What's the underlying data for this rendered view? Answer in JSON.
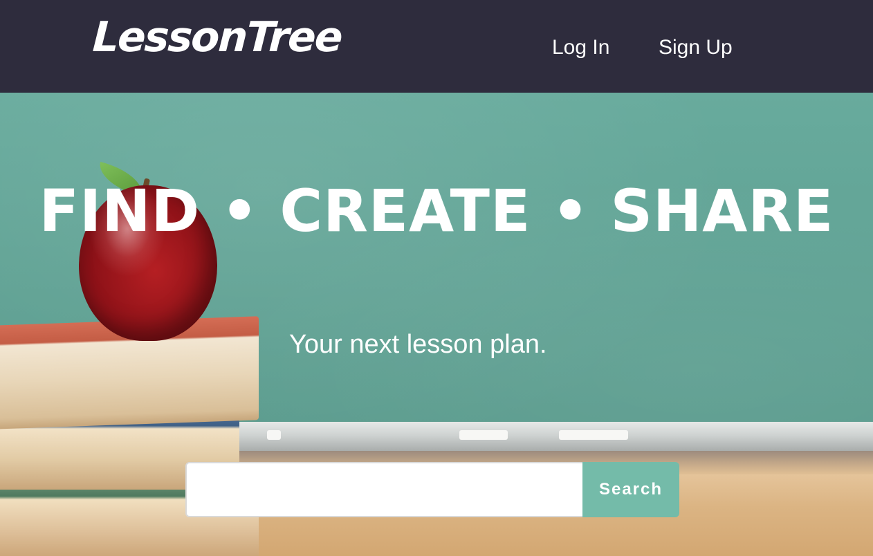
{
  "header": {
    "logo_text": "LessonTree",
    "nav": {
      "login_label": "Log In",
      "signup_label": "Sign Up"
    }
  },
  "hero": {
    "headline": "FIND • CREATE • SHARE",
    "tagline": "Your next lesson plan."
  },
  "search": {
    "value": "",
    "placeholder": "",
    "button_label": "Search"
  },
  "colors": {
    "header_bg": "#2e2c3d",
    "chalkboard": "#5fa193",
    "search_button": "#74bba9",
    "text": "#ffffff"
  }
}
